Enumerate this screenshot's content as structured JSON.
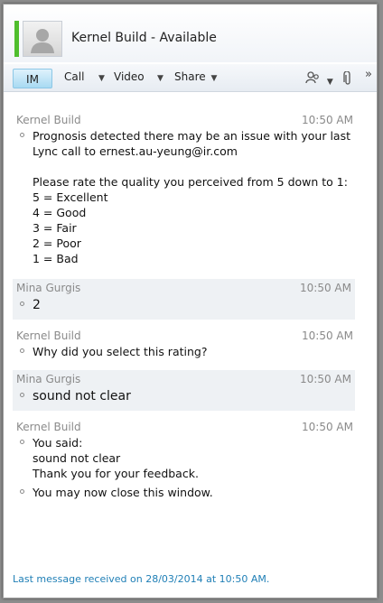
{
  "window": {
    "title": "Kernel Build - Available",
    "presence_color": "#4fbe2d"
  },
  "toolbar": {
    "im_label": "IM",
    "call_label": "Call",
    "video_label": "Video",
    "share_label": "Share",
    "overflow_label": "»",
    "icons": [
      "people-options-icon",
      "paperclip-icon"
    ]
  },
  "messages": [
    {
      "sender": "Kernel Build",
      "time": "10:50 AM",
      "shaded": false,
      "lines": [
        "Prognosis detected there may be an issue with your last",
        "Lync call to ernest.au-yeung@ir.com",
        "",
        "Please rate the quality you perceived from 5 down to 1:",
        "5 = Excellent",
        "4 = Good",
        "3 = Fair",
        "2 = Poor",
        "1 = Bad"
      ]
    },
    {
      "sender": "Mina Gurgis",
      "time": "10:50 AM",
      "shaded": true,
      "lines": [
        "2"
      ]
    },
    {
      "sender": "Kernel Build",
      "time": "10:50 AM",
      "shaded": false,
      "lines": [
        "Why did you select this rating?"
      ]
    },
    {
      "sender": "Mina Gurgis",
      "time": "10:50 AM",
      "shaded": true,
      "lines": [
        "sound not clear"
      ]
    },
    {
      "sender": "Kernel Build",
      "time": "10:50 AM",
      "shaded": false,
      "lines_a": [
        "You said:",
        "sound not clear",
        "Thank you for your feedback."
      ],
      "lines_b": [
        "You may now close this window."
      ]
    }
  ],
  "footer": {
    "status_text": "Last message received on 28/03/2014 at 10:50 AM."
  }
}
